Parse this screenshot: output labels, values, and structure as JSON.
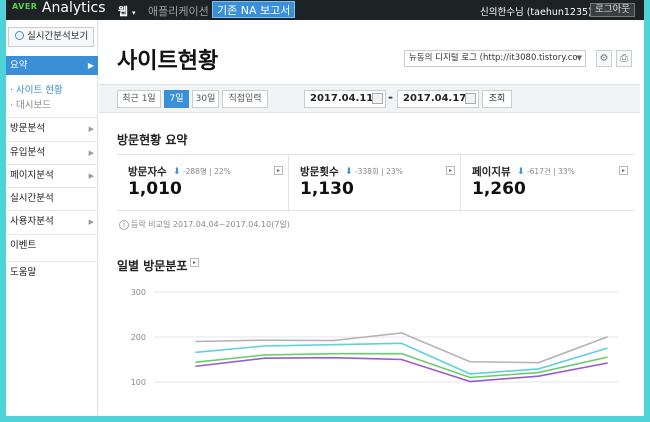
{
  "topbar": {
    "logo_brand": "AVER",
    "logo_text": "Analytics",
    "nav_web": "웹",
    "nav_app": "애플리케이션",
    "nav_na": "기존 NA 보고서",
    "user": "신의한수님 (taehun1235)",
    "logout": "로그아웃"
  },
  "sidebar": {
    "realtime_button": "실시간분석보기",
    "summary": "요약",
    "sub_active": "· 사이트 현황",
    "sub_dashboard": "· 대시보드",
    "menu": [
      "방문분석",
      "유입분석",
      "페이지분석",
      "실시간분석",
      "사용자분석",
      "이벤트",
      "도움말"
    ]
  },
  "main": {
    "title": "사이트현황",
    "site_select": "뉴동의 디지털 로그 (http://it3080.tistory.co",
    "periods": [
      "최근 1일",
      "7일",
      "30일",
      "직접입력"
    ],
    "active_period": "7일",
    "date_from": "2017.04.11",
    "date_dash": "-",
    "date_to": "2017.04.17",
    "query": "조회",
    "summary_title": "방문현황 요약",
    "metrics": [
      {
        "label": "방문자수",
        "change": "-288명",
        "pct": "22%",
        "value": "1,010"
      },
      {
        "label": "방문횟수",
        "change": "-338회",
        "pct": "23%",
        "value": "1,130"
      },
      {
        "label": "페이지뷰",
        "change": "-617건",
        "pct": "33%",
        "value": "1,260"
      }
    ],
    "compare_text": "등락 비교일  2017.04.04~2017.04.10(7일)",
    "chart_title": "일별 방문분포"
  },
  "colors": {
    "accent": "#3a8fd6",
    "series_gray": "#b3b3b8",
    "series_cyan": "#5fd0dc",
    "series_green": "#63d06b",
    "series_purple": "#9b5bd0"
  },
  "chart_data": {
    "type": "line",
    "title": "일별 방문분포",
    "xlabel": "",
    "ylabel": "",
    "ylim": [
      100,
      300
    ],
    "yticks": [
      300,
      200,
      100
    ],
    "x": [
      1,
      2,
      3,
      4,
      5,
      6,
      7
    ],
    "grid": true,
    "series": [
      {
        "values": [
          190,
          193,
          192,
          209,
          145,
          143,
          200
        ]
      },
      {
        "values": [
          166,
          180,
          183,
          186,
          118,
          129,
          175
        ]
      },
      {
        "values": [
          144,
          160,
          163,
          163,
          110,
          121,
          155
        ]
      },
      {
        "values": [
          135,
          153,
          154,
          150,
          101,
          113,
          142
        ]
      }
    ]
  }
}
